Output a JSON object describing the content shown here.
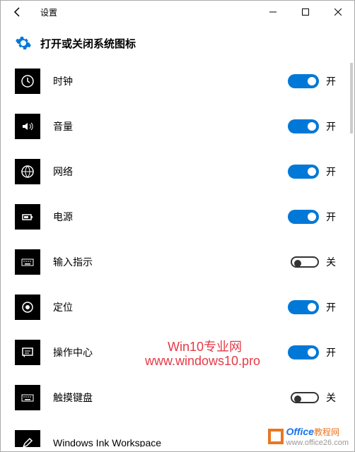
{
  "titlebar": {
    "app_title": "设置"
  },
  "header": {
    "title": "打开或关闭系统图标"
  },
  "toggle_labels": {
    "on": "开",
    "off": "关"
  },
  "items": [
    {
      "label": "时钟",
      "state": "on"
    },
    {
      "label": "音量",
      "state": "on"
    },
    {
      "label": "网络",
      "state": "on"
    },
    {
      "label": "电源",
      "state": "on"
    },
    {
      "label": "输入指示",
      "state": "off"
    },
    {
      "label": "定位",
      "state": "on"
    },
    {
      "label": "操作中心",
      "state": "on"
    },
    {
      "label": "触摸键盘",
      "state": "off"
    },
    {
      "label": "Windows Ink Workspace",
      "state": "on"
    }
  ],
  "watermark": {
    "line1": "Win10专业网",
    "line2": "www.windows10.pro",
    "logo_text1": "Office",
    "logo_text2": "教程网",
    "logo_text3": "www.office26.com"
  }
}
